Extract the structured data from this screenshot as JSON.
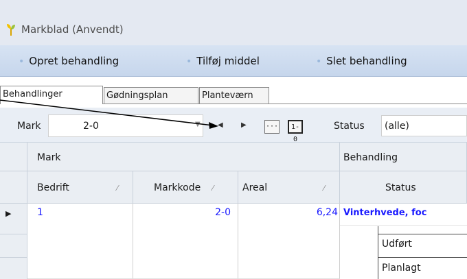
{
  "window": {
    "title": "Markblad (Anvendt)"
  },
  "ribbon": {
    "items": [
      "Opret behandling",
      "Tilføj middel",
      "Slet behandling"
    ]
  },
  "tabs": [
    "Behandlinger",
    "Gødningsplan",
    "Planteværn"
  ],
  "filter": {
    "mark_label": "Mark",
    "mark_value": "2-0",
    "more_button": "···",
    "range_button": "1-0",
    "status_label": "Status",
    "status_value": "(alle)"
  },
  "grid": {
    "group_headers": {
      "mark": "Mark",
      "behandling": "Behandling"
    },
    "columns": {
      "bedrift": "Bedrift",
      "markkode": "Markkode",
      "areal": "Areal",
      "status": "Status"
    },
    "row": {
      "bedrift": "1",
      "markkode": "2-0",
      "areal": "6,24",
      "behandling": "Vinterhvede, foc"
    },
    "sub_rows": [
      "Udført",
      "Planlagt"
    ]
  },
  "colors": {
    "accent_link": "#1a1aff",
    "ribbon": "#c6d6ec",
    "titlebar": "#e4e9f2"
  }
}
